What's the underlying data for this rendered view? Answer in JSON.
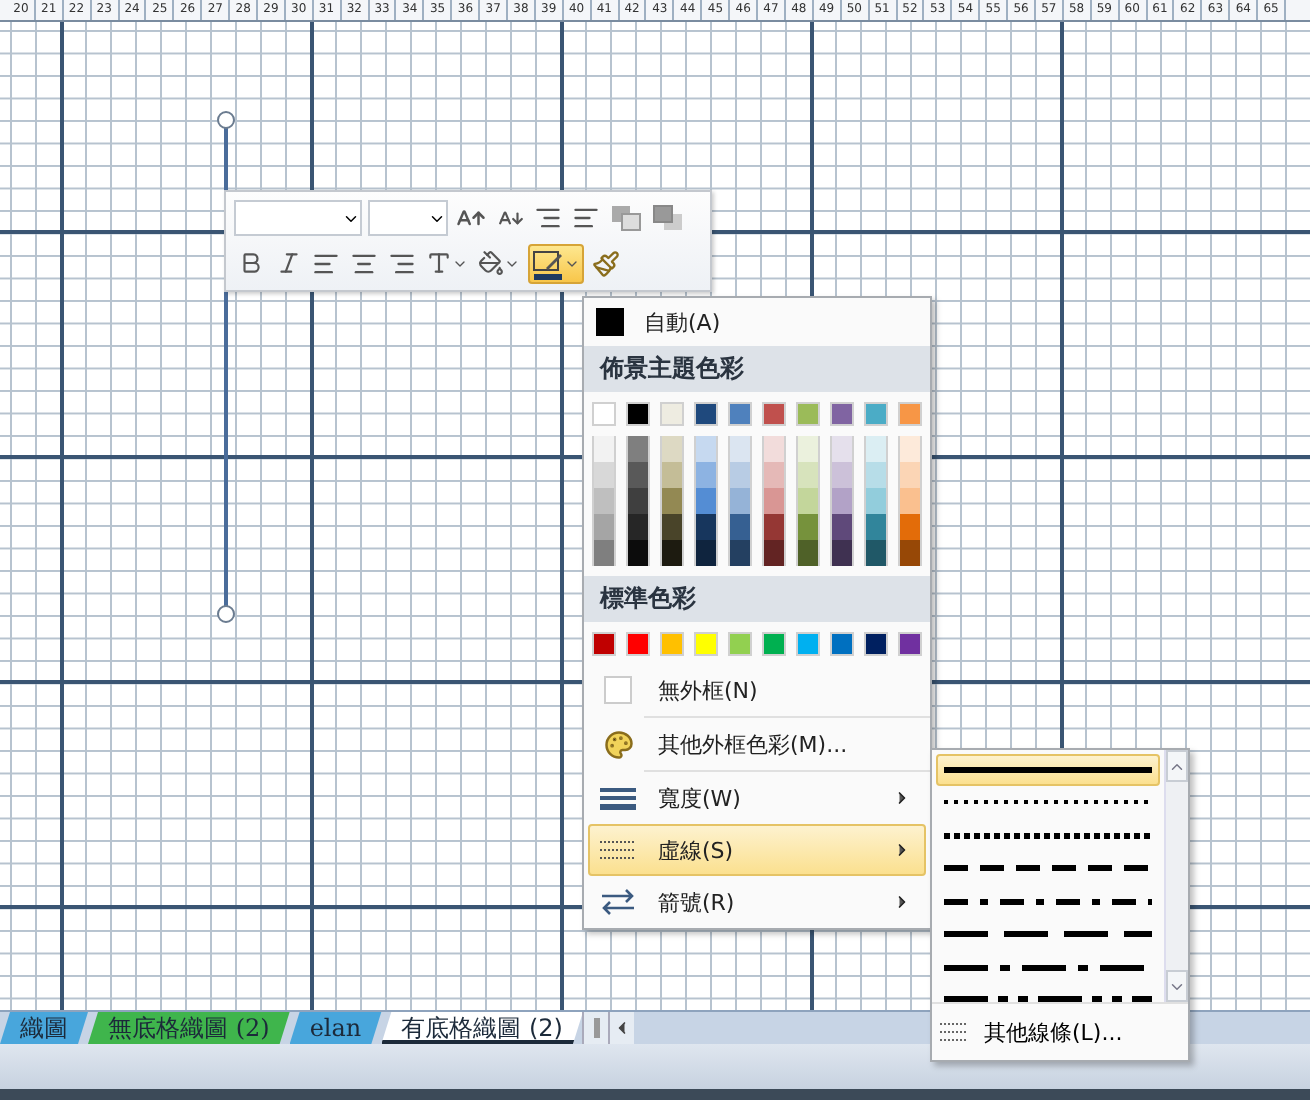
{
  "ruler": [
    "20",
    "21",
    "22",
    "23",
    "24",
    "25",
    "26",
    "27",
    "28",
    "29",
    "30",
    "31",
    "32",
    "33",
    "34",
    "35",
    "36",
    "37",
    "38",
    "39",
    "40",
    "41",
    "42",
    "43",
    "44",
    "45",
    "46",
    "47",
    "48",
    "49",
    "50",
    "51",
    "52",
    "53",
    "54",
    "55",
    "56",
    "57",
    "58",
    "59",
    "60",
    "61",
    "62",
    "63",
    "64",
    "65"
  ],
  "toolbar": {
    "line_color_button": {
      "selected": true
    }
  },
  "menu": {
    "auto": {
      "label": "自動(A)",
      "color": "#000000"
    },
    "theme_heading": "佈景主題色彩",
    "theme_rows": [
      {
        "swatches": [
          {
            "color": "#ffffff"
          },
          {
            "color": "#000000"
          },
          {
            "color": "#eeece1"
          },
          {
            "color": "#1f497d"
          },
          {
            "color": "#4f81bd"
          },
          {
            "color": "#c0504d"
          },
          {
            "color": "#9bbb59"
          },
          {
            "color": "#8064a2"
          },
          {
            "color": "#4bacc6"
          },
          {
            "color": "#f79646"
          }
        ]
      },
      {
        "swatches": [
          {
            "color": "#f2f2f2"
          },
          {
            "color": "#7f7f7f"
          },
          {
            "color": "#ddd9c3"
          },
          {
            "color": "#c6d9f0"
          },
          {
            "color": "#dbe5f1"
          },
          {
            "color": "#f2dcdb"
          },
          {
            "color": "#ebf1dd"
          },
          {
            "color": "#e5e0ec"
          },
          {
            "color": "#dbeef3"
          },
          {
            "color": "#fdeada"
          }
        ]
      },
      {
        "swatches": [
          {
            "color": "#d8d8d8"
          },
          {
            "color": "#595959"
          },
          {
            "color": "#c4bd97"
          },
          {
            "color": "#8db3e2"
          },
          {
            "color": "#b8cce4"
          },
          {
            "color": "#e5b9b7"
          },
          {
            "color": "#d7e3bc"
          },
          {
            "color": "#ccc1d9"
          },
          {
            "color": "#b7dde8"
          },
          {
            "color": "#fbd5b5"
          }
        ]
      },
      {
        "swatches": [
          {
            "color": "#bfbfbf"
          },
          {
            "color": "#3f3f3f"
          },
          {
            "color": "#938953"
          },
          {
            "color": "#548dd4"
          },
          {
            "color": "#95b3d7"
          },
          {
            "color": "#d99694"
          },
          {
            "color": "#c3d69b"
          },
          {
            "color": "#b2a2c7"
          },
          {
            "color": "#92cddc"
          },
          {
            "color": "#fac08f"
          }
        ]
      },
      {
        "swatches": [
          {
            "color": "#a5a5a5"
          },
          {
            "color": "#262626"
          },
          {
            "color": "#494429"
          },
          {
            "color": "#17365d"
          },
          {
            "color": "#366092"
          },
          {
            "color": "#953734"
          },
          {
            "color": "#76923c"
          },
          {
            "color": "#5f497a"
          },
          {
            "color": "#31859b"
          },
          {
            "color": "#e36c09"
          }
        ]
      },
      {
        "swatches": [
          {
            "color": "#7f7f7f"
          },
          {
            "color": "#0c0c0c"
          },
          {
            "color": "#1d1b10"
          },
          {
            "color": "#0f243e"
          },
          {
            "color": "#244061"
          },
          {
            "color": "#632423"
          },
          {
            "color": "#4f6128"
          },
          {
            "color": "#3f3151"
          },
          {
            "color": "#205867"
          },
          {
            "color": "#974806"
          }
        ]
      }
    ],
    "standard_heading": "標準色彩",
    "standard_colors": [
      {
        "color": "#c00000"
      },
      {
        "color": "#ff0000"
      },
      {
        "color": "#ffc000"
      },
      {
        "color": "#ffff00"
      },
      {
        "color": "#92d050"
      },
      {
        "color": "#00b050"
      },
      {
        "color": "#00b0f0"
      },
      {
        "color": "#0070c0"
      },
      {
        "color": "#002060"
      },
      {
        "color": "#7030a0"
      }
    ],
    "items": [
      {
        "kind": "no-border",
        "label": "無外框(N)",
        "submenu": false,
        "selected": false
      },
      {
        "kind": "more-colors",
        "label": "其他外框色彩(M)...",
        "submenu": false,
        "selected": false
      },
      {
        "kind": "weight",
        "label": "寬度(W)",
        "submenu": true,
        "selected": false
      },
      {
        "kind": "dashes",
        "label": "虛線(S)",
        "submenu": true,
        "selected": true
      },
      {
        "kind": "arrows",
        "label": "箭號(R)",
        "submenu": true,
        "selected": false
      }
    ]
  },
  "dash_menu": {
    "styles": [
      {
        "kind": "solid",
        "selected": true
      },
      {
        "kind": "round-dot",
        "selected": false
      },
      {
        "kind": "square-dot",
        "selected": false
      },
      {
        "kind": "dash",
        "selected": false
      },
      {
        "kind": "dash-dot",
        "selected": false
      },
      {
        "kind": "long-dash",
        "selected": false
      },
      {
        "kind": "long-dash-dot",
        "selected": false
      },
      {
        "kind": "long-dash-dot-dot",
        "selected": false
      }
    ],
    "more_label": "其他線條(L)..."
  },
  "sheet_tabs": [
    {
      "label": "織圖",
      "color": "#48a6dc",
      "selected": false
    },
    {
      "label": "無底格織圖 (2)",
      "color": "#3fb54c",
      "selected": false
    },
    {
      "label": "elan",
      "color": "#48a6dc",
      "selected": false
    },
    {
      "label": "有底格織圖 (2)",
      "color": "#ffffff",
      "selected": true
    }
  ]
}
